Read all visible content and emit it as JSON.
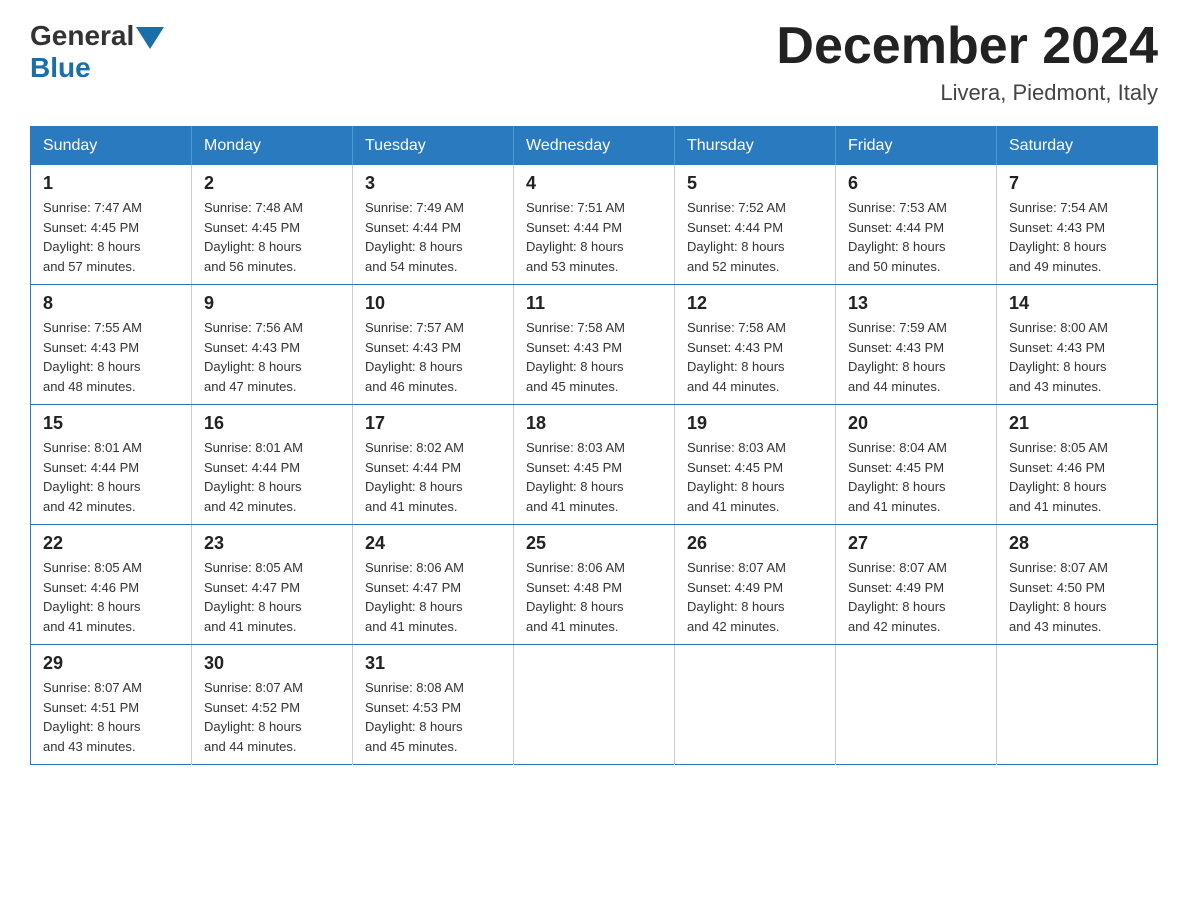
{
  "header": {
    "logo_general": "General",
    "logo_blue": "Blue",
    "month_title": "December 2024",
    "location": "Livera, Piedmont, Italy"
  },
  "weekdays": [
    "Sunday",
    "Monday",
    "Tuesday",
    "Wednesday",
    "Thursday",
    "Friday",
    "Saturday"
  ],
  "weeks": [
    [
      {
        "day": "1",
        "sunrise": "7:47 AM",
        "sunset": "4:45 PM",
        "daylight": "8 hours and 57 minutes."
      },
      {
        "day": "2",
        "sunrise": "7:48 AM",
        "sunset": "4:45 PM",
        "daylight": "8 hours and 56 minutes."
      },
      {
        "day": "3",
        "sunrise": "7:49 AM",
        "sunset": "4:44 PM",
        "daylight": "8 hours and 54 minutes."
      },
      {
        "day": "4",
        "sunrise": "7:51 AM",
        "sunset": "4:44 PM",
        "daylight": "8 hours and 53 minutes."
      },
      {
        "day": "5",
        "sunrise": "7:52 AM",
        "sunset": "4:44 PM",
        "daylight": "8 hours and 52 minutes."
      },
      {
        "day": "6",
        "sunrise": "7:53 AM",
        "sunset": "4:44 PM",
        "daylight": "8 hours and 50 minutes."
      },
      {
        "day": "7",
        "sunrise": "7:54 AM",
        "sunset": "4:43 PM",
        "daylight": "8 hours and 49 minutes."
      }
    ],
    [
      {
        "day": "8",
        "sunrise": "7:55 AM",
        "sunset": "4:43 PM",
        "daylight": "8 hours and 48 minutes."
      },
      {
        "day": "9",
        "sunrise": "7:56 AM",
        "sunset": "4:43 PM",
        "daylight": "8 hours and 47 minutes."
      },
      {
        "day": "10",
        "sunrise": "7:57 AM",
        "sunset": "4:43 PM",
        "daylight": "8 hours and 46 minutes."
      },
      {
        "day": "11",
        "sunrise": "7:58 AM",
        "sunset": "4:43 PM",
        "daylight": "8 hours and 45 minutes."
      },
      {
        "day": "12",
        "sunrise": "7:58 AM",
        "sunset": "4:43 PM",
        "daylight": "8 hours and 44 minutes."
      },
      {
        "day": "13",
        "sunrise": "7:59 AM",
        "sunset": "4:43 PM",
        "daylight": "8 hours and 44 minutes."
      },
      {
        "day": "14",
        "sunrise": "8:00 AM",
        "sunset": "4:43 PM",
        "daylight": "8 hours and 43 minutes."
      }
    ],
    [
      {
        "day": "15",
        "sunrise": "8:01 AM",
        "sunset": "4:44 PM",
        "daylight": "8 hours and 42 minutes."
      },
      {
        "day": "16",
        "sunrise": "8:01 AM",
        "sunset": "4:44 PM",
        "daylight": "8 hours and 42 minutes."
      },
      {
        "day": "17",
        "sunrise": "8:02 AM",
        "sunset": "4:44 PM",
        "daylight": "8 hours and 41 minutes."
      },
      {
        "day": "18",
        "sunrise": "8:03 AM",
        "sunset": "4:45 PM",
        "daylight": "8 hours and 41 minutes."
      },
      {
        "day": "19",
        "sunrise": "8:03 AM",
        "sunset": "4:45 PM",
        "daylight": "8 hours and 41 minutes."
      },
      {
        "day": "20",
        "sunrise": "8:04 AM",
        "sunset": "4:45 PM",
        "daylight": "8 hours and 41 minutes."
      },
      {
        "day": "21",
        "sunrise": "8:05 AM",
        "sunset": "4:46 PM",
        "daylight": "8 hours and 41 minutes."
      }
    ],
    [
      {
        "day": "22",
        "sunrise": "8:05 AM",
        "sunset": "4:46 PM",
        "daylight": "8 hours and 41 minutes."
      },
      {
        "day": "23",
        "sunrise": "8:05 AM",
        "sunset": "4:47 PM",
        "daylight": "8 hours and 41 minutes."
      },
      {
        "day": "24",
        "sunrise": "8:06 AM",
        "sunset": "4:47 PM",
        "daylight": "8 hours and 41 minutes."
      },
      {
        "day": "25",
        "sunrise": "8:06 AM",
        "sunset": "4:48 PM",
        "daylight": "8 hours and 41 minutes."
      },
      {
        "day": "26",
        "sunrise": "8:07 AM",
        "sunset": "4:49 PM",
        "daylight": "8 hours and 42 minutes."
      },
      {
        "day": "27",
        "sunrise": "8:07 AM",
        "sunset": "4:49 PM",
        "daylight": "8 hours and 42 minutes."
      },
      {
        "day": "28",
        "sunrise": "8:07 AM",
        "sunset": "4:50 PM",
        "daylight": "8 hours and 43 minutes."
      }
    ],
    [
      {
        "day": "29",
        "sunrise": "8:07 AM",
        "sunset": "4:51 PM",
        "daylight": "8 hours and 43 minutes."
      },
      {
        "day": "30",
        "sunrise": "8:07 AM",
        "sunset": "4:52 PM",
        "daylight": "8 hours and 44 minutes."
      },
      {
        "day": "31",
        "sunrise": "8:08 AM",
        "sunset": "4:53 PM",
        "daylight": "8 hours and 45 minutes."
      },
      null,
      null,
      null,
      null
    ]
  ],
  "labels": {
    "sunrise": "Sunrise:",
    "sunset": "Sunset:",
    "daylight": "Daylight:"
  }
}
